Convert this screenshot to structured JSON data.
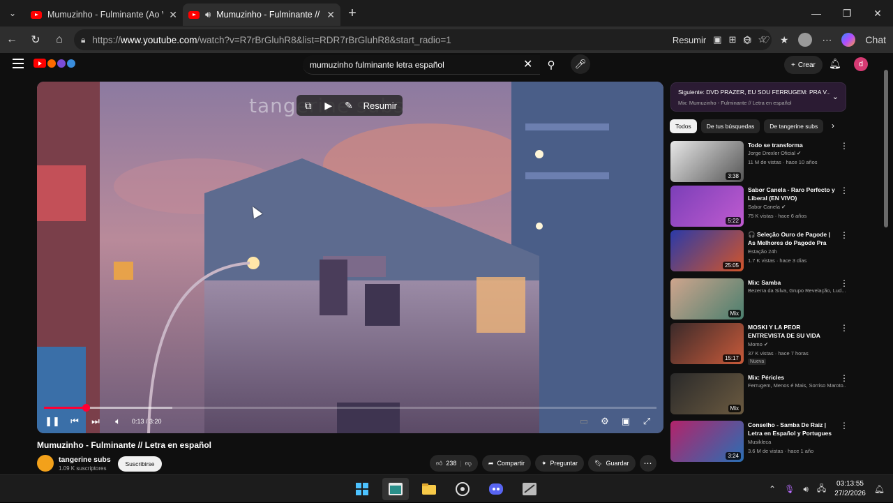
{
  "browser": {
    "tabs": [
      {
        "title": "Mumuzinho - Fulminante (Ao Viv",
        "active": false
      },
      {
        "title": "Mumuzinho - Fulminante // L",
        "active": true
      }
    ],
    "url_prefix": "https://",
    "url_host": "www.youtube.com",
    "url_path": "/watch?v=R7rBrGluhR8&list=RDR7rBrGluhR8&start_radio=1",
    "resumir_label": "Resumir",
    "chat_label": "Chat"
  },
  "youtube": {
    "search_value": "mumuzinho fulminante letra español",
    "create_label": "Crear",
    "avatar_letter": "d",
    "player": {
      "watermark": "tangerine subs",
      "overlay_resumir": "Resumir",
      "time": "0:13 / 3:20",
      "progress_fraction": 0.068
    },
    "video_title": "Mumuzinho - Fulminante // Letra en español",
    "channel": {
      "name": "tangerine subs",
      "subs": "1.09 K suscriptores",
      "subscribe_label": "Suscribirse"
    },
    "actions": {
      "likes": "238",
      "share": "Compartir",
      "ask": "Preguntar",
      "save": "Guardar"
    },
    "up_next": {
      "title": "Siguiente: DVD PRAZER, EU SOU FERRUGEM: PRA V...",
      "subtitle": "Mix: Mumuzinho - Fulminante // Letra en español"
    },
    "chips": [
      "Todos",
      "De tus búsquedas",
      "De tangerine subs"
    ],
    "recommendations": [
      {
        "title": "Todo se transforma",
        "channel": "Jorge Drexler Oficial ✔",
        "stats": "11 M de vistas · hace 10 años",
        "duration": "3:38",
        "color1": "#e8e8e8",
        "color2": "#555"
      },
      {
        "title": "Sabor Canela - Raro Perfecto y Liberal (EN VIVO)",
        "channel": "Sabor Canela ✔",
        "stats": "75 K vistas · hace 6 años",
        "duration": "5:22",
        "color1": "#7b3fb8",
        "color2": "#c05bd0"
      },
      {
        "title": "🎧 Seleção Ouro de Pagode | As Melhores do Pagode Pra Curtir ...",
        "channel": "Estação 24h",
        "stats": "1.7 K vistas · hace 3 días",
        "duration": "25:05",
        "color1": "#2b3aa8",
        "color2": "#d2552a"
      },
      {
        "title": "Mix: Samba",
        "channel": "Bezerra da Silva, Grupo Revelação, Lud...",
        "stats": "",
        "duration": "Mix",
        "color1": "#cfa58d",
        "color2": "#4a7f6e"
      },
      {
        "title": "MOSKI Y LA PEOR ENTREVISTA DE SU VIDA",
        "channel": "Momo ✔",
        "stats": "37 K vistas · hace 7 horas",
        "duration": "15:17",
        "badge": "Nueva",
        "color1": "#3a2a2a",
        "color2": "#c95a3a"
      },
      {
        "title": "Mix: Péricles",
        "channel": "Ferrugem, Menos é Mais, Sorriso Maroto...",
        "stats": "",
        "duration": "Mix",
        "color1": "#2a2a2a",
        "color2": "#6b5a40"
      },
      {
        "title": "Conselho - Samba De Raiz | Letra en Español y Portugues",
        "channel": "Musikleca",
        "stats": "3.6 M de vistas · hace 1 año",
        "duration": "3:24",
        "color1": "#b3236a",
        "color2": "#2a6fb4"
      }
    ]
  },
  "taskbar": {
    "time": "03:13:55",
    "date": "27/2/2026"
  },
  "colors": {
    "accent": "#ff0033",
    "bg": "#0f0f0f"
  }
}
